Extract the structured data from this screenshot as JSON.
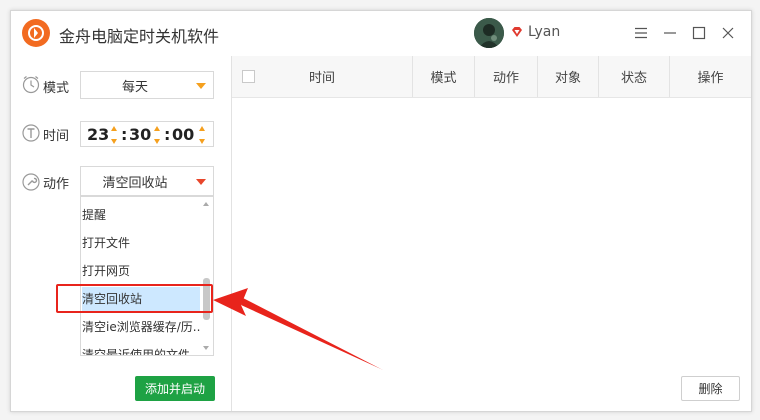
{
  "app": {
    "title": "金舟电脑定时关机软件",
    "username": "Lyan",
    "accent": "#f26b21"
  },
  "window_controls": {
    "menu_icon": "hamburger-menu-icon",
    "minimize_icon": "minimize-icon",
    "maximize_icon": "maximize-icon",
    "close_icon": "close-icon"
  },
  "sidebar": {
    "mode": {
      "label": "模式",
      "value": "每天",
      "icon": "clock-icon"
    },
    "time": {
      "label": "时间",
      "hour": "23",
      "minute": "30",
      "second": "00",
      "icon": "timer-icon"
    },
    "action": {
      "label": "动作",
      "value": "清空回收站",
      "icon": "wrench-icon"
    },
    "action_options": [
      "提醒",
      "打开文件",
      "打开网页",
      "清空回收站",
      "清空ie浏览器缓存/历..",
      "清空最近使用的文件"
    ],
    "selected_option": "清空回收站",
    "add_button": "添加并启动",
    "add_button_color": "#1ea244"
  },
  "table": {
    "columns": [
      "时间",
      "模式",
      "动作",
      "对象",
      "状态",
      "操作"
    ],
    "rows": []
  },
  "delete_button": "删除",
  "annotation_color": "#e8241c"
}
